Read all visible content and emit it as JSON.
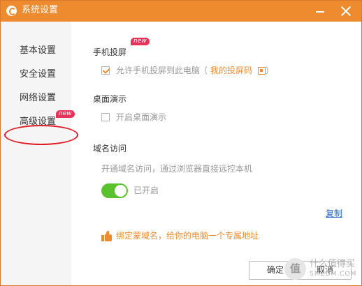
{
  "window": {
    "title": "系统设置"
  },
  "sidebar": {
    "items": [
      {
        "label": "基本设置"
      },
      {
        "label": "安全设置"
      },
      {
        "label": "网络设置"
      },
      {
        "label": "高级设置",
        "badge": "new"
      }
    ]
  },
  "mobile_cast": {
    "title": "手机投屏",
    "badge": "new",
    "checked": true,
    "option_label": "允许手机投屏到此电脑",
    "paren_open": "（",
    "link_label": "我的投屏码",
    "paren_close": "）"
  },
  "desktop_demo": {
    "title": "桌面演示",
    "checked": false,
    "option_label": "开启桌面演示"
  },
  "domain_access": {
    "title": "域名访问",
    "description": "开通域名访问，通过浏览器直接远控本机",
    "toggle_on": true,
    "toggle_status": "已开启",
    "copy_link": "复制",
    "promo_text": "绑定蒙域名，给你的电脑一个专属地址"
  },
  "footer": {
    "confirm_label": "确定",
    "cancel_label": "取消"
  },
  "watermark": {
    "logo_text": "值",
    "text": "什么值得买",
    "sub": "SMZDM.COM"
  },
  "colors": {
    "accent": "#ef8b2f",
    "toggle_on": "#5ac12f",
    "badge": "#e8325a",
    "link": "#2869c9"
  }
}
